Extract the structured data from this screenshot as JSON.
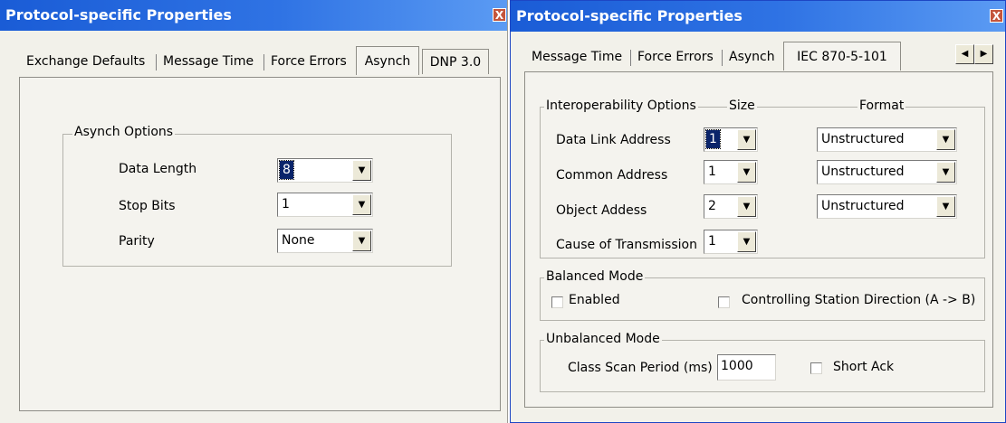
{
  "left_dialog": {
    "title": "Protocol-specific Properties",
    "close_glyph": "X",
    "tabs": [
      {
        "label": "Exchange Defaults"
      },
      {
        "label": "Message Time"
      },
      {
        "label": "Force Errors"
      },
      {
        "label": "Asynch",
        "selected": true
      },
      {
        "label": "DNP 3.0"
      }
    ],
    "asynch_options": {
      "group_label": "Asynch Options",
      "data_length": {
        "label": "Data Length",
        "value": "8"
      },
      "stop_bits": {
        "label": "Stop Bits",
        "value": "1"
      },
      "parity": {
        "label": "Parity",
        "value": "None"
      }
    }
  },
  "right_dialog": {
    "title": "Protocol-specific Properties",
    "close_glyph": "X",
    "tabs": [
      {
        "label": "Message Time"
      },
      {
        "label": "Force Errors"
      },
      {
        "label": "Asynch"
      },
      {
        "label": "IEC 870-5-101",
        "selected": true
      }
    ],
    "scroll_left_glyph": "◀",
    "scroll_right_glyph": "▶",
    "interoperability": {
      "group_label": "Interoperability Options",
      "size_header": "Size",
      "format_header": "Format",
      "data_link_address": {
        "label": "Data Link Address",
        "size": "1",
        "format": "Unstructured"
      },
      "common_address": {
        "label": "Common Address",
        "size": "1",
        "format": "Unstructured"
      },
      "object_address": {
        "label": "Object Addess",
        "size": "2",
        "format": "Unstructured"
      },
      "cause_of_transmission": {
        "label": "Cause of Transmission",
        "size": "1"
      }
    },
    "balanced_mode": {
      "group_label": "Balanced Mode",
      "enabled": {
        "label": "Enabled",
        "checked": false
      },
      "controlling_station": {
        "label": "Controlling Station Direction (A -> B)",
        "checked": false
      }
    },
    "unbalanced_mode": {
      "group_label": "Unbalanced Mode",
      "class_scan_period": {
        "label": "Class Scan Period (ms)",
        "value": "1000"
      },
      "short_ack": {
        "label": "Short Ack",
        "checked": false
      }
    }
  },
  "icons": {
    "dropdown_arrow": "▼"
  }
}
